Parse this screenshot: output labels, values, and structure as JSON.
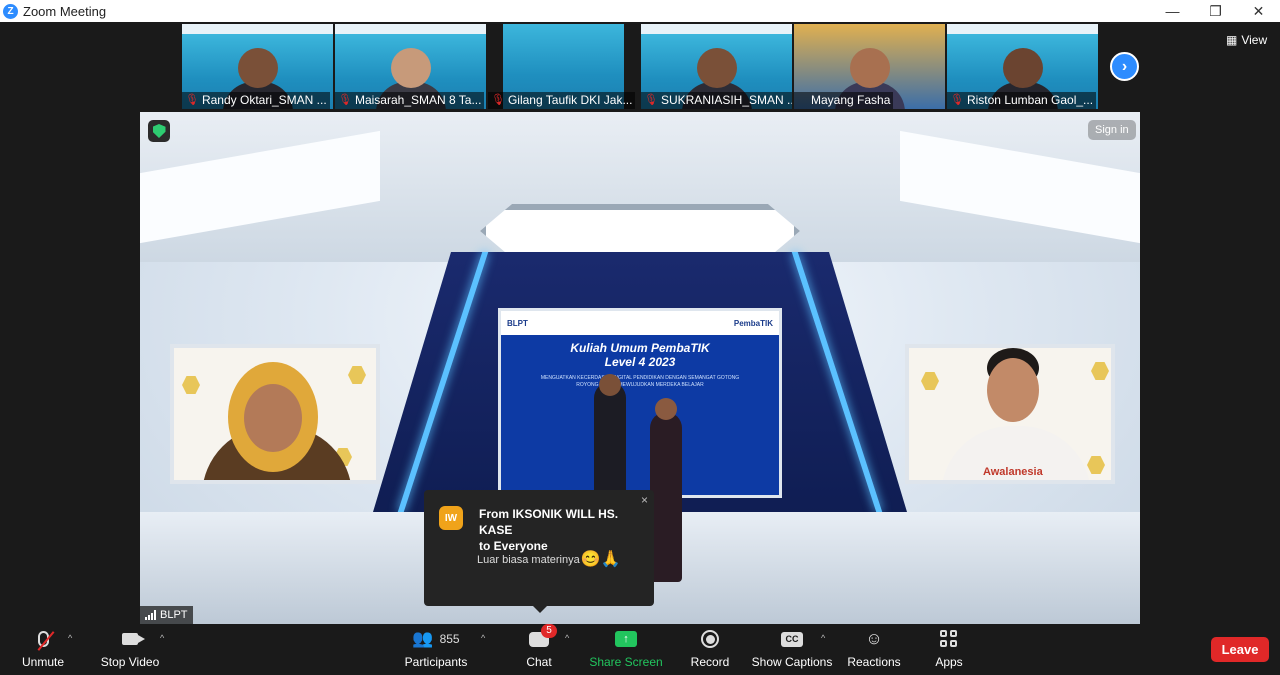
{
  "window": {
    "title": "Zoom Meeting",
    "logo_letter": "Z",
    "controls": {
      "minimize": "—",
      "maximize": "❐",
      "close": "✕"
    }
  },
  "gallery": {
    "participants": [
      {
        "name": "Randy Oktari_SMAN ...",
        "muted": true,
        "skin": "#7a5038",
        "shirt": "#27272f"
      },
      {
        "name": "Maisarah_SMAN 8 Ta...",
        "muted": true,
        "skin": "#c79a7a",
        "shirt": "#3b3b45"
      },
      {
        "name": "Gilang Taufik DKI Jak...",
        "muted": true,
        "skin": "",
        "shirt": ""
      },
      {
        "name": "SUKRANIASIH_SMAN ...",
        "muted": true,
        "skin": "#7a5038",
        "shirt": "#2c2c36"
      },
      {
        "name": "Mayang Fasha",
        "muted": false,
        "skin": "#a87050",
        "shirt": "#3a3a58"
      },
      {
        "name": "Riston Lumban Gaol_...",
        "muted": true,
        "skin": "#6b4430",
        "shirt": "#26262e"
      }
    ],
    "next_icon": "›",
    "view_label": "View"
  },
  "main_video": {
    "screen_title_line1": "Kuliah Umum PembaTIK",
    "screen_title_line2": "Level 4 2023",
    "screen_subtitle": "MENGUATKAN KECERDASAN DIGITAL PENDIDIKAN DENGAN SEMANGAT GOTONG ROYONG UNTUK MEWUJUDKAN MERDEKA BELAJAR",
    "screen_logo_left": "BLPT",
    "screen_logo_right": "PembaTIK",
    "right_person_shirt_text": "Awalanesia",
    "sign_in_label": "Sign in",
    "speaker_name": "BLPT"
  },
  "chat_popup": {
    "avatar_initials": "IW",
    "from_line": "From IKSONIK WILL HS. KASE",
    "to_line": "to Everyone",
    "message": "Luar biasa materinya",
    "emojis": "😊🙏",
    "close_glyph": "×"
  },
  "toolbar": {
    "unmute_label": "Unmute",
    "stop_video_label": "Stop Video",
    "participants_label": "Participants",
    "participants_count": "855",
    "chat_label": "Chat",
    "chat_badge": "5",
    "share_label": "Share Screen",
    "record_label": "Record",
    "captions_label": "Show Captions",
    "captions_icon": "CC",
    "reactions_label": "Reactions",
    "apps_label": "Apps",
    "leave_label": "Leave",
    "caret": "^"
  },
  "colors": {
    "accent_blue": "#2d8cff",
    "share_green": "#22c55e",
    "leave_red": "#e02828",
    "background": "#1a1a1a"
  }
}
